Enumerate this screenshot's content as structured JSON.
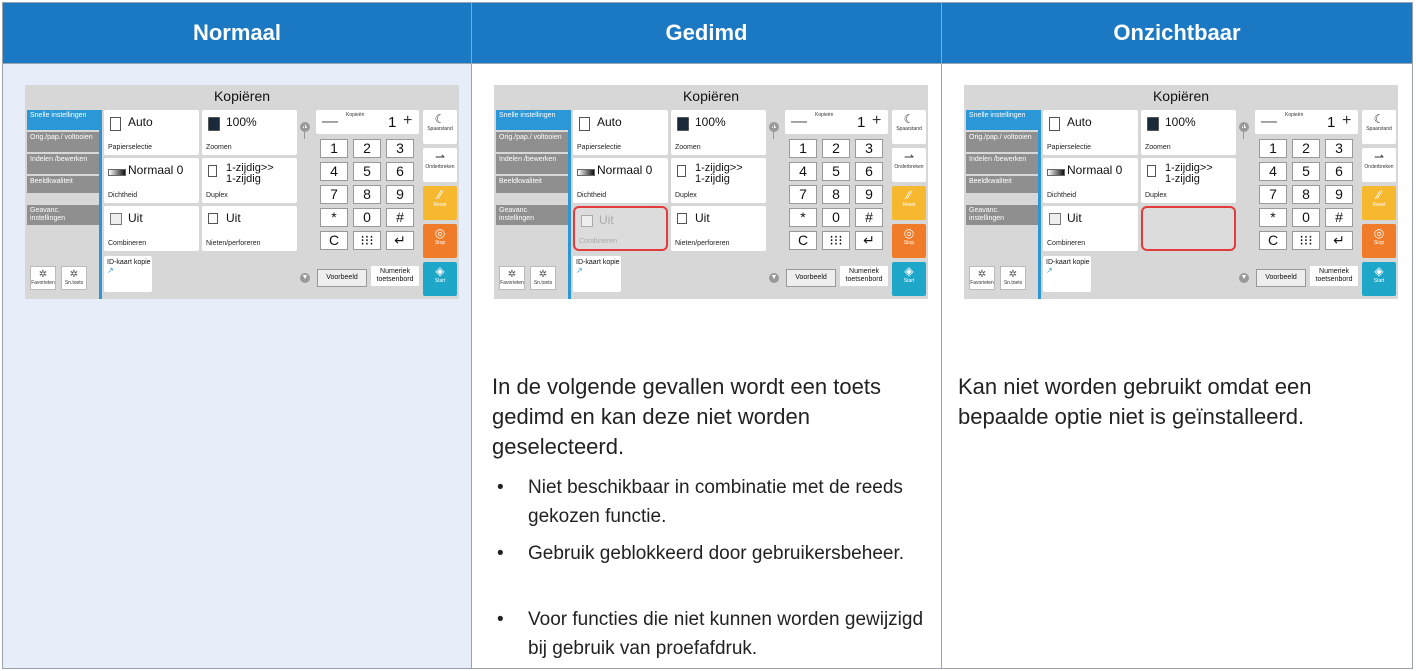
{
  "columns": [
    {
      "header": "Normaal"
    },
    {
      "header": "Gedimd"
    },
    {
      "header": "Onzichtbaar"
    }
  ],
  "screen": {
    "title": "Kopiëren",
    "tabs": [
      "Snelle instellingen",
      "Orig./pap./ voltooien",
      "Indelen /bewerken",
      "Beeldkwaliteit",
      "Geavanc. instellingen"
    ],
    "fav_buttons": [
      "Favorieten",
      "Sn.toets"
    ],
    "tiles": {
      "papier_val": "Auto",
      "papier_lbl": "Papierselectie",
      "zoom_val": "100%",
      "zoom_lbl": "Zoomen",
      "dicht_val": "Normaal 0",
      "dicht_lbl": "Dichtheid",
      "duplex_val": "1-zijdig>> 1-zijdig",
      "duplex_lbl": "Duplex",
      "comb_val": "Uit",
      "comb_lbl": "Combineren",
      "niet_val": "Uit",
      "niet_lbl": "Nieten/perforeren",
      "idkaart": "ID-kaart kopie"
    },
    "copies_label": "Kopieën",
    "copies_value": "1",
    "keys": [
      "1",
      "2",
      "3",
      "4",
      "5",
      "6",
      "7",
      "8",
      "9",
      "*",
      "0",
      "#",
      "C",
      "⁝⁝⁝",
      "↵"
    ],
    "right_buttons": [
      "Spaarstand",
      "Onderbreken",
      "Reset",
      "Stop",
      "Start"
    ],
    "voorbeeld": "Voorbeeld",
    "numeriek": "Numeriek toetsenbord"
  },
  "gedimd": {
    "intro": "In de volgende gevallen wordt een toets gedimd en kan deze niet worden geselecteerd.",
    "bullets": [
      "Niet beschikbaar in combinatie met de reeds gekozen functie.",
      "Gebruik geblokkeerd door gebruikersbeheer.",
      "Voor functies die niet kunnen worden gewijzigd bij gebruik van proefafdruk."
    ]
  },
  "onzichtbaar": {
    "text": "Kan niet worden gebruikt omdat een bepaalde optie niet is geïnstalleerd."
  },
  "colors": {
    "header": "#1b79c3",
    "tab_active": "#2c97d6",
    "reset": "#f5b82e",
    "stop": "#f07c2a",
    "start": "#1fa7c9",
    "dim_border": "#e23b3b"
  }
}
